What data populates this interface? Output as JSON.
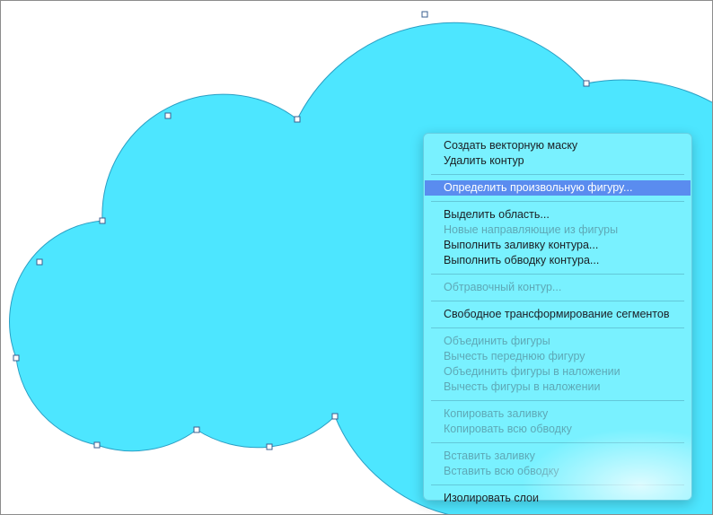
{
  "canvas": {
    "background": "#ffffff",
    "shape_fill": "#4de6ff",
    "shape_stroke": "#2a9fc4"
  },
  "context_menu": {
    "groups": [
      {
        "items": [
          {
            "id": "create-vector-mask",
            "label": "Создать векторную маску",
            "enabled": true
          },
          {
            "id": "delete-path",
            "label": "Удалить контур",
            "enabled": true
          }
        ]
      },
      {
        "items": [
          {
            "id": "define-custom-shape",
            "label": "Определить произвольную фигуру...",
            "enabled": true,
            "selected": true
          }
        ]
      },
      {
        "items": [
          {
            "id": "make-selection",
            "label": "Выделить область...",
            "enabled": true
          },
          {
            "id": "new-guides-from-shape",
            "label": "Новые направляющие из фигуры",
            "enabled": false
          },
          {
            "id": "fill-path",
            "label": "Выполнить заливку контура...",
            "enabled": true
          },
          {
            "id": "stroke-path",
            "label": "Выполнить обводку контура...",
            "enabled": true
          }
        ]
      },
      {
        "items": [
          {
            "id": "clipping-path",
            "label": "Обтравочный контур...",
            "enabled": false
          }
        ]
      },
      {
        "items": [
          {
            "id": "free-transform-segments",
            "label": "Свободное трансформирование сегментов",
            "enabled": true
          }
        ]
      },
      {
        "items": [
          {
            "id": "unite-shapes",
            "label": "Объединить фигуры",
            "enabled": false
          },
          {
            "id": "subtract-front-shape",
            "label": "Вычесть переднюю фигуру",
            "enabled": false
          },
          {
            "id": "unite-shapes-overlap",
            "label": "Объединить фигуры в наложении",
            "enabled": false
          },
          {
            "id": "subtract-shapes-overlap",
            "label": "Вычесть фигуры в наложении",
            "enabled": false
          }
        ]
      },
      {
        "items": [
          {
            "id": "copy-fill",
            "label": "Копировать заливку",
            "enabled": false
          },
          {
            "id": "copy-all-strokes",
            "label": "Копировать всю обводку",
            "enabled": false
          }
        ]
      },
      {
        "items": [
          {
            "id": "paste-fill",
            "label": "Вставить заливку",
            "enabled": false
          },
          {
            "id": "paste-all-strokes",
            "label": "Вставить всю обводку",
            "enabled": false
          }
        ]
      },
      {
        "items": [
          {
            "id": "isolate-layers",
            "label": "Изолировать слои",
            "enabled": true
          }
        ]
      }
    ]
  }
}
